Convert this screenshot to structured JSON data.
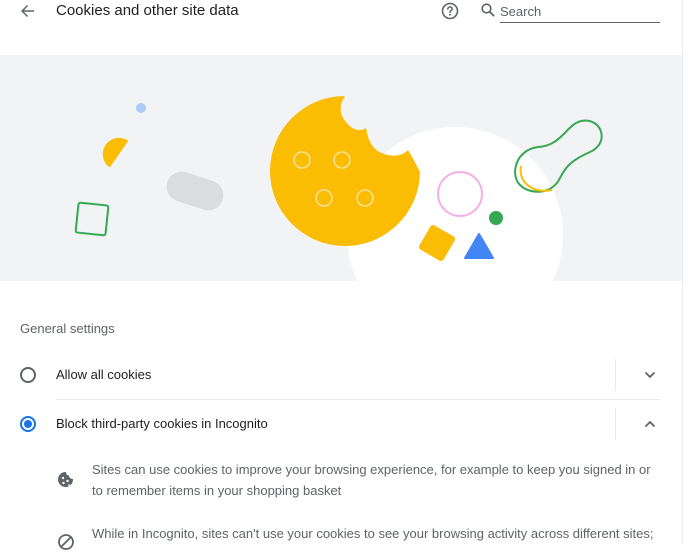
{
  "header": {
    "title": "Cookies and other site data",
    "search_placeholder": "Search",
    "search_value": ""
  },
  "general": {
    "section_title": "General settings",
    "options": [
      {
        "label": "Allow all cookies",
        "selected": false,
        "expanded": false
      },
      {
        "label": "Block third-party cookies in Incognito",
        "selected": true,
        "expanded": true
      }
    ],
    "details": [
      {
        "icon": "cookie-icon",
        "text": "Sites can use cookies to improve your browsing experience, for example to keep you signed in or to remember items in your shopping basket"
      },
      {
        "icon": "block-icon",
        "text": "While in Incognito, sites can't use your cookies to see your browsing activity across different sites;"
      }
    ]
  },
  "colors": {
    "accent": "#1a73e8",
    "cookie": "#fbbc04",
    "green": "#34a853",
    "blue": "#4285f4",
    "pink": "#f28be6",
    "banner_bg": "#f1f3f4"
  }
}
